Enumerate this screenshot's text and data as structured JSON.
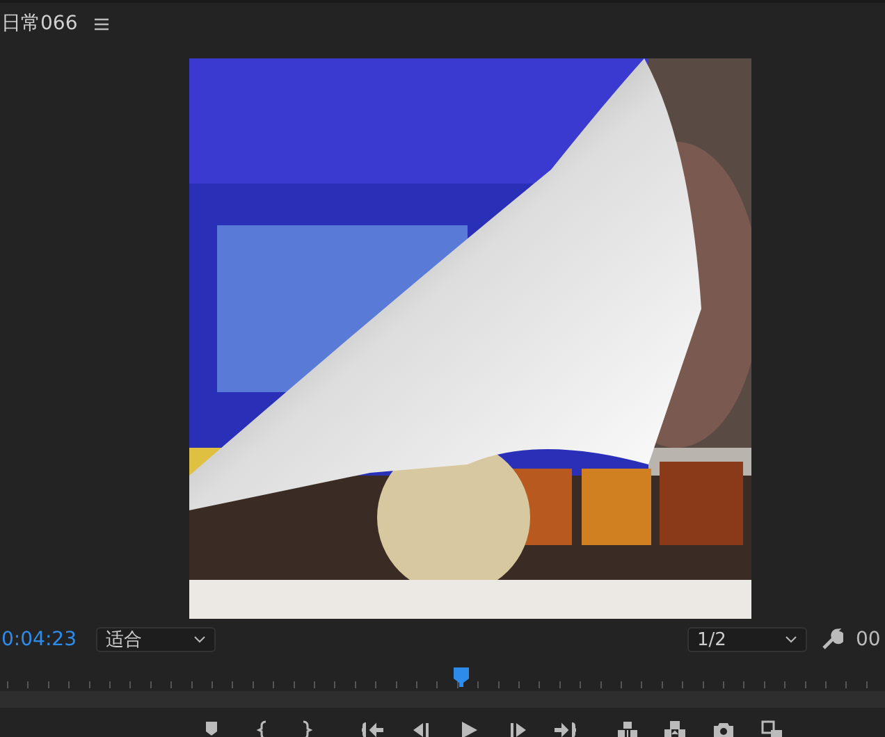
{
  "panel": {
    "title": "日常066"
  },
  "settings_bar": {
    "timecode": "0:04:23",
    "zoom": {
      "value": "适合"
    },
    "resolution": {
      "value": "1/2"
    },
    "duration": "00"
  },
  "timeline": {
    "playhead": {
      "level": 0.52
    }
  },
  "transport": [
    {
      "kind": "marker"
    },
    {
      "kind": "mark-in"
    },
    {
      "kind": "mark-out"
    },
    {
      "kind": "go-in"
    },
    {
      "kind": "step-back"
    },
    {
      "kind": "play"
    },
    {
      "kind": "step-forward"
    },
    {
      "kind": "go-out"
    },
    {
      "kind": "lift"
    },
    {
      "kind": "extract"
    },
    {
      "kind": "export-frame"
    },
    {
      "kind": "compare"
    }
  ]
}
